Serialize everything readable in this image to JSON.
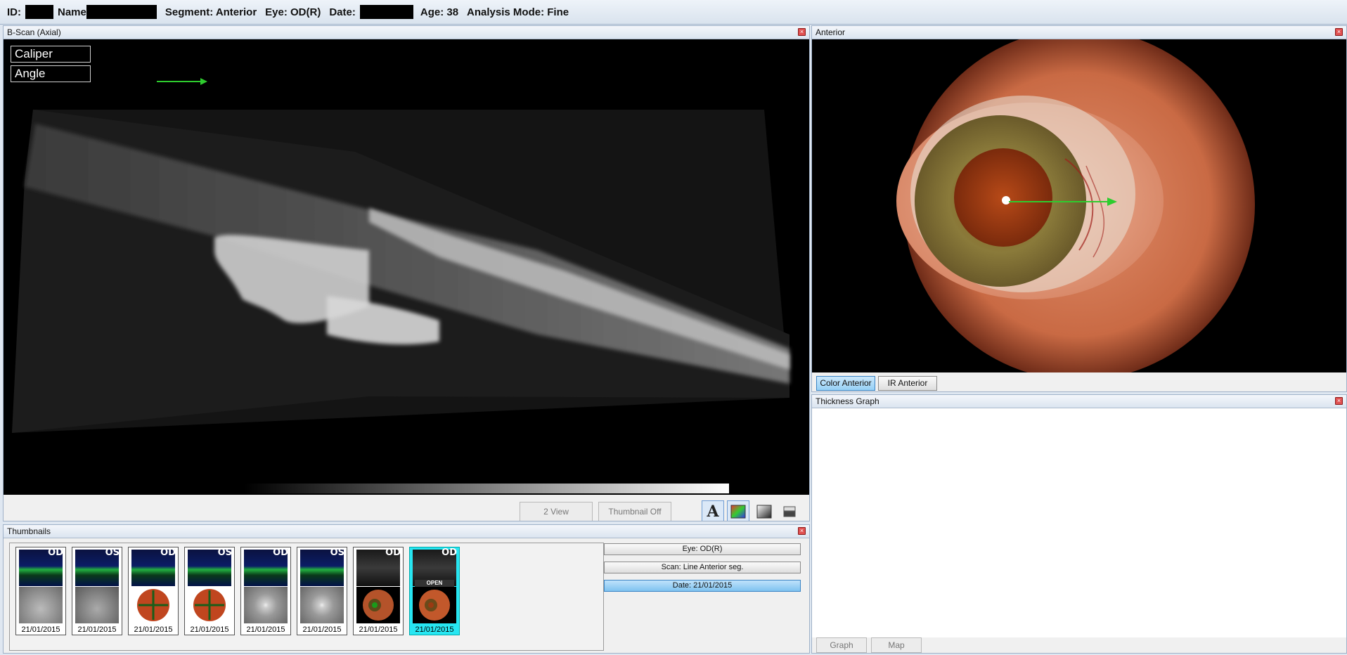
{
  "header": {
    "id_label": "ID:",
    "name_label": "Name",
    "segment": "Segment: Anterior",
    "eye": "Eye: OD(R)",
    "date_label": "Date:",
    "age": "Age: 38",
    "analysis_mode": "Analysis Mode: Fine"
  },
  "bscan": {
    "title": "B-Scan (Axial)",
    "tools": [
      "Caliper",
      "Angle"
    ],
    "two_view_label": "2 View",
    "thumbnail_off_label": "Thumbnail Off",
    "icons": [
      "font-a-icon",
      "color-map-icon",
      "grayscale-icon",
      "gradient-icon"
    ]
  },
  "thumbnails": {
    "title": "Thumbnails",
    "items": [
      {
        "eye": "OD",
        "date": "21/01/2015",
        "kind": "fundus",
        "selected": false
      },
      {
        "eye": "OS",
        "date": "21/01/2015",
        "kind": "fundus",
        "selected": false
      },
      {
        "eye": "OD",
        "date": "21/01/2015",
        "kind": "cross",
        "selected": false
      },
      {
        "eye": "OS",
        "date": "21/01/2015",
        "kind": "cross",
        "selected": false
      },
      {
        "eye": "OD",
        "date": "21/01/2015",
        "kind": "disc",
        "selected": false
      },
      {
        "eye": "OS",
        "date": "21/01/2015",
        "kind": "disc",
        "selected": false
      },
      {
        "eye": "OD",
        "date": "21/01/2015",
        "kind": "anterior",
        "selected": false
      },
      {
        "eye": "OD",
        "date": "21/01/2015",
        "kind": "anterior-open",
        "selected": true,
        "badge": "OPEN"
      }
    ],
    "filters": {
      "eye": "Eye: OD(R)",
      "scan": "Scan: Line Anterior seg.",
      "date": "Date: 21/01/2015"
    }
  },
  "anterior": {
    "title": "Anterior",
    "tabs": [
      "Color Anterior",
      "IR Anterior"
    ],
    "selected_tab": 0
  },
  "thickness": {
    "title": "Thickness Graph",
    "buttons": [
      "Graph",
      "Map"
    ]
  },
  "colors": {
    "caliper_arrow": "#2ecc2e",
    "selected_thumb": "#27e6f2",
    "selected_button": "#7fc3f0"
  }
}
